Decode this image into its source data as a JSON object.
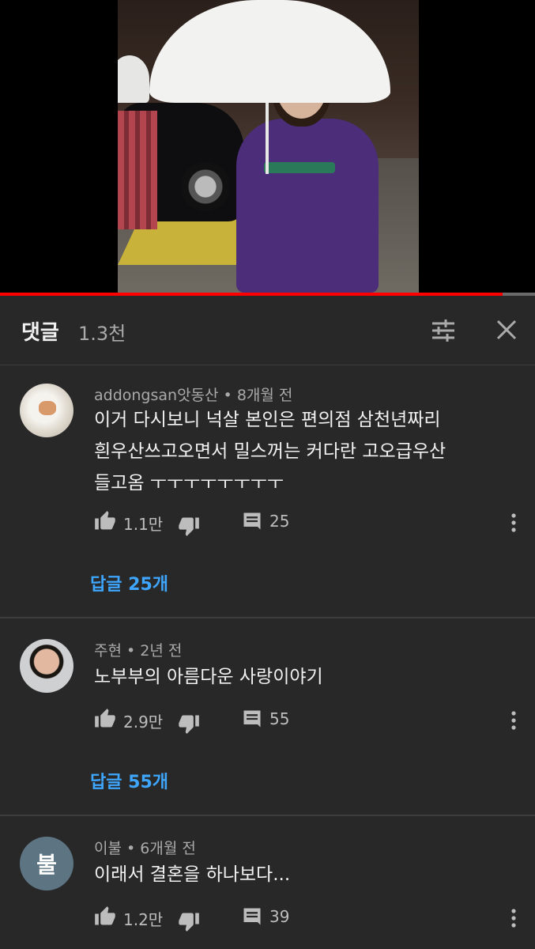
{
  "video": {
    "progress": 0.94
  },
  "header": {
    "title": "댓글",
    "count": "1.3천",
    "sort_icon": "sort-icon",
    "close_icon": "close-icon"
  },
  "comments": [
    {
      "author": "addongsan앗동산",
      "time": "8개월 전",
      "lines": [
        "이거 다시보니 넉살 본인은 편의점 삼천년짜리",
        "흰우산쓰고오면서 밀스꺼는 커다란 고오급우산",
        "들고옴 ㅜㅜㅜㅜㅜㅜㅜㅜ"
      ],
      "likes": "1.1만",
      "reply_count": "25",
      "replies_label": "답글 25개"
    },
    {
      "author": "주현",
      "time": "2년 전",
      "lines": [
        "노부부의 아름다운 사랑이야기"
      ],
      "likes": "2.9만",
      "reply_count": "55",
      "replies_label": "답글 55개"
    },
    {
      "author": "이불",
      "avatar_letter": "불",
      "time": "6개월 전",
      "lines": [
        "이래서 결혼을 하나보다..."
      ],
      "likes": "1.2만",
      "reply_count": "39"
    }
  ],
  "colors": {
    "background": "#282828",
    "link": "#3ea6ff",
    "progress": "#ff0000"
  }
}
